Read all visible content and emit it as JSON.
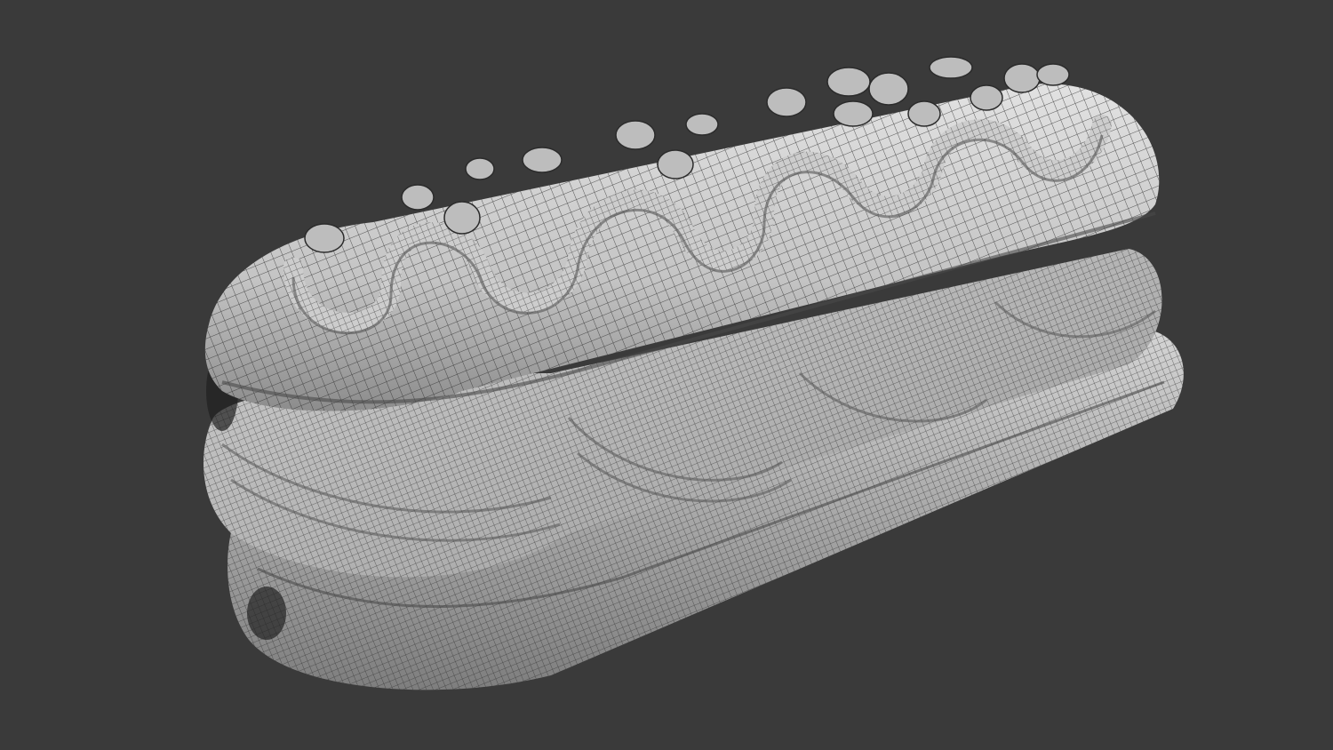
{
  "viewport": {
    "background": "#3a3a3a",
    "render_mode": "wireframe-on-shaded",
    "subject": "eclair"
  },
  "colors": {
    "surface_light": "#d9d9d9",
    "surface_mid": "#a9a9a9",
    "surface_dark": "#5a5a5a",
    "wire": "#2b2b2b"
  },
  "model_parts": {
    "top_shell": "eclair-top-shell",
    "cream_filling": "whipped-cream-filling",
    "bottom_shell": "eclair-bottom-shell",
    "icing_drizzle": "icing-drizzle",
    "nut_toppings": "chopped-nut-toppings"
  }
}
